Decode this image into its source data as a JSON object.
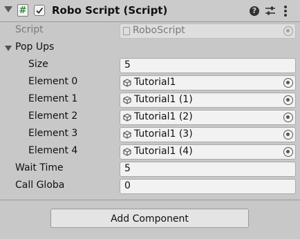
{
  "header": {
    "title": "Robo Script (Script)",
    "script_icon_glyph": "#",
    "enabled": true,
    "help_glyph": "?",
    "icons": [
      "foldout-icon",
      "script-icon",
      "enabled-checkbox",
      "help-icon",
      "presets-icon",
      "context-menu-icon"
    ]
  },
  "script_field": {
    "label": "Script",
    "value": "RoboScript"
  },
  "popups": {
    "label": "Pop Ups",
    "expanded": true,
    "size_label": "Size",
    "size_value": "5",
    "elements": [
      {
        "label": "Element 0",
        "value": "Tutorial1"
      },
      {
        "label": "Element 1",
        "value": "Tutorial1 (1)"
      },
      {
        "label": "Element 2",
        "value": "Tutorial1 (2)"
      },
      {
        "label": "Element 3",
        "value": "Tutorial1 (3)"
      },
      {
        "label": "Element 4",
        "value": "Tutorial1 (4)"
      }
    ]
  },
  "wait_time": {
    "label": "Wait Time",
    "value": "5"
  },
  "call_global": {
    "label": "Call Globa",
    "value": "0"
  },
  "add_component": {
    "label": "Add Component"
  }
}
